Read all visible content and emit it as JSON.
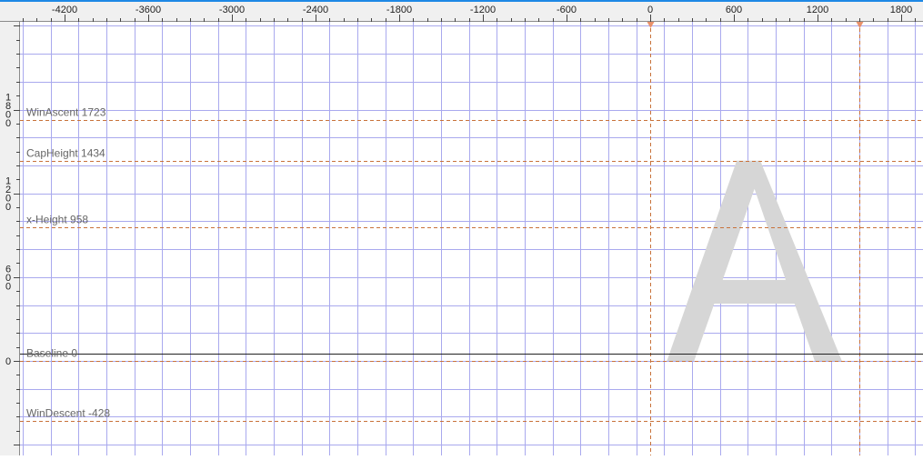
{
  "window": {
    "accent_color": "#1e88e5"
  },
  "ruler": {
    "h_ticks": [
      {
        "value": -4200,
        "label": "-4200"
      },
      {
        "value": -3600,
        "label": "-3600"
      },
      {
        "value": -3000,
        "label": "-3000"
      },
      {
        "value": -2400,
        "label": "-2400"
      },
      {
        "value": -1800,
        "label": "-1800"
      },
      {
        "value": -1200,
        "label": "-1200"
      },
      {
        "value": -600,
        "label": "-600"
      },
      {
        "value": 0,
        "label": "0"
      },
      {
        "value": 600,
        "label": "600"
      },
      {
        "value": 1200,
        "label": "1200"
      },
      {
        "value": 1800,
        "label": "1800"
      }
    ],
    "v_ticks": [
      {
        "value": 1800,
        "label": "1800"
      },
      {
        "value": 1200,
        "label": "1200"
      },
      {
        "value": 600,
        "label": "600"
      },
      {
        "value": 0,
        "label": "0"
      }
    ]
  },
  "metrics": [
    {
      "name": "WinAscent",
      "value": 1723,
      "label": "WinAscent 1723"
    },
    {
      "name": "CapHeight",
      "value": 1434,
      "label": "CapHeight 1434"
    },
    {
      "name": "x-Height",
      "value": 958,
      "label": "x-Height 958"
    },
    {
      "name": "Baseline",
      "value": 0,
      "label": "Baseline 0"
    },
    {
      "name": "WinDescent",
      "value": -428,
      "label": "WinDescent -428"
    }
  ],
  "glyph": {
    "character": "A",
    "advance_width": 1500,
    "fill": "#d6d6d6"
  },
  "colors": {
    "grid": "#a9a9ee",
    "guide": "#c8723a",
    "ruler_bg": "#f0f0f0",
    "metric_text": "#666666"
  }
}
